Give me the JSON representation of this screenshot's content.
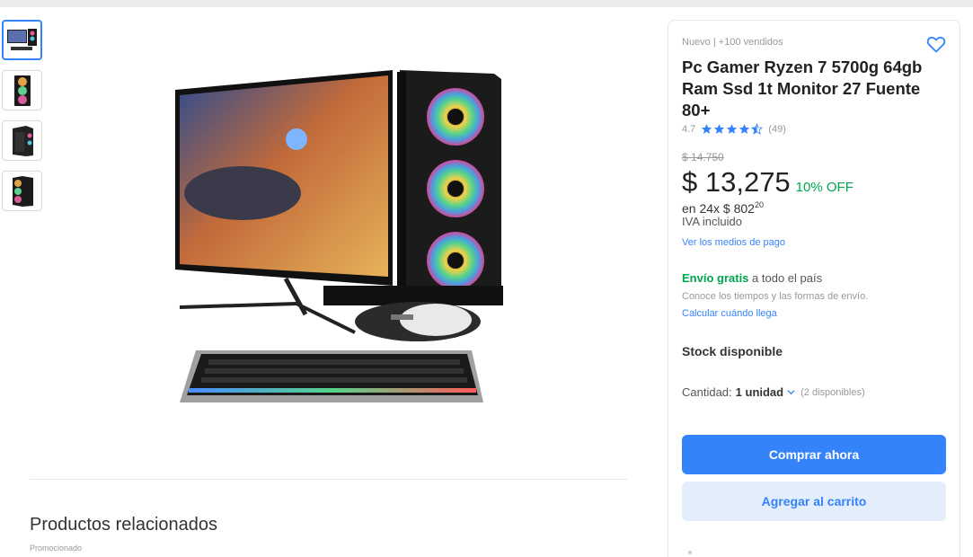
{
  "condition": "Nuevo  |  +100 vendidos",
  "title": "Pc Gamer Ryzen 7 5700g 64gb Ram Ssd 1t Monitor 27 Fuente 80+",
  "rating": {
    "score": "4.7",
    "stars": 4.5,
    "count": "(49)"
  },
  "price": {
    "old": "$ 14.750",
    "current": "$ 13,275",
    "discount": "10% OFF",
    "installments_text": "en 24x $ 802",
    "installments_cents": "20",
    "tax": "IVA incluido",
    "payment_link": "Ver los medios de pago"
  },
  "shipping": {
    "free": "Envío gratis",
    "rest": " a todo el país",
    "note": "Conoce los tiempos y las formas de envío.",
    "calc_link": "Calcular cuándo llega"
  },
  "stock": "Stock disponible",
  "quantity": {
    "label": "Cantidad:",
    "value": "1 unidad",
    "available": "(2 disponibles)"
  },
  "buttons": {
    "buy": "Comprar ahora",
    "cart": "Agregar al carrito"
  },
  "related": {
    "title": "Productos relacionados",
    "promoted": "Promocionado"
  },
  "colors": {
    "accent": "#3483fa",
    "green": "#00a650",
    "cart_bg": "#e3edfb"
  },
  "thumbnails": [
    "pc-set-thumbnail",
    "case-front-thumbnail",
    "case-side-thumbnail",
    "case-angle-thumbnail"
  ]
}
